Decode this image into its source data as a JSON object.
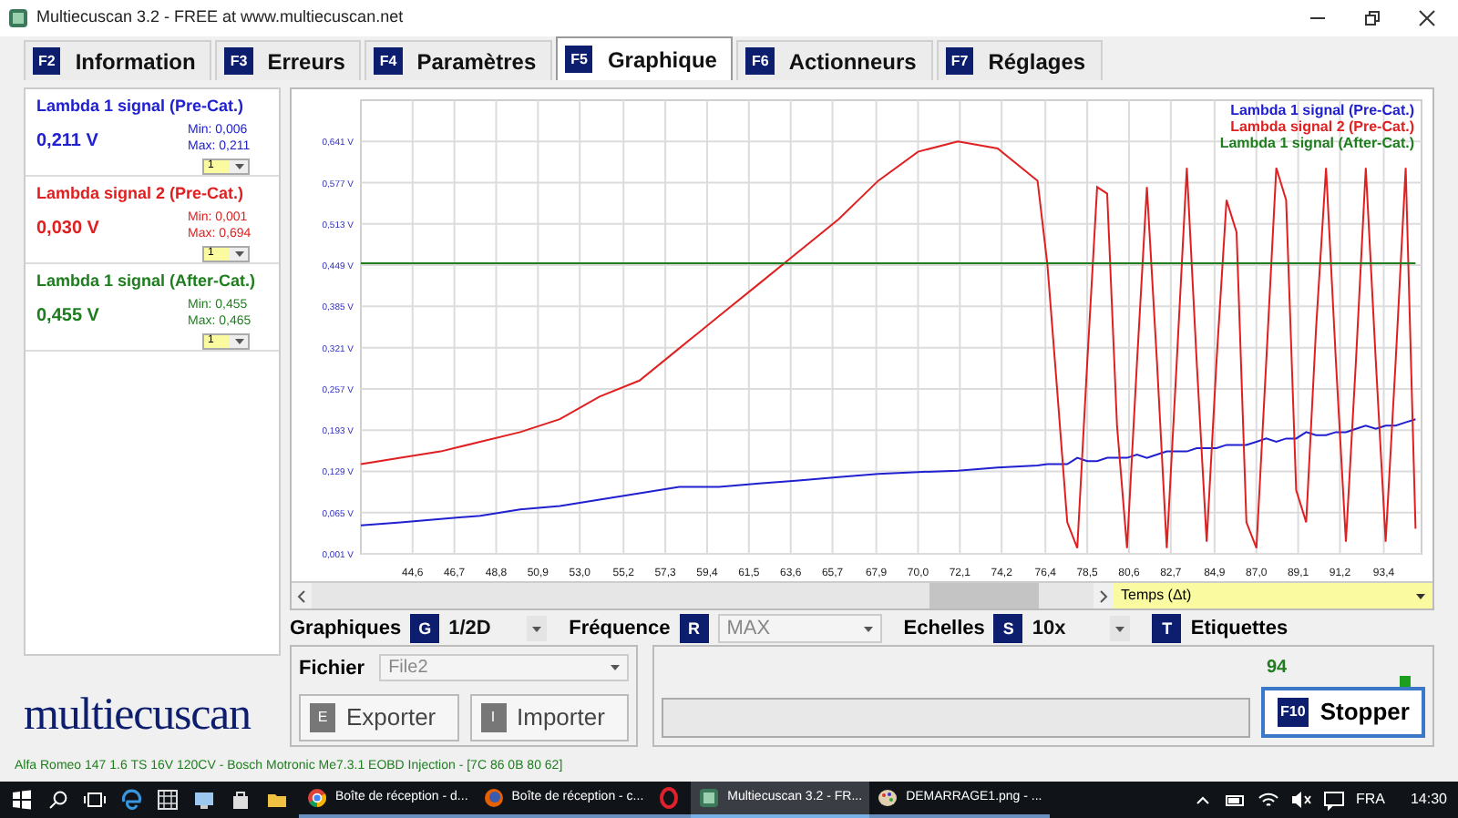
{
  "window": {
    "title": "Multiecuscan 3.2 - FREE at www.multiecuscan.net"
  },
  "tabs": [
    {
      "key": "F2",
      "label": "Information",
      "selected": false
    },
    {
      "key": "F3",
      "label": "Erreurs",
      "selected": false
    },
    {
      "key": "F4",
      "label": "Paramètres",
      "selected": false
    },
    {
      "key": "F5",
      "label": "Graphique",
      "selected": true
    },
    {
      "key": "F6",
      "label": "Actionneurs",
      "selected": false
    },
    {
      "key": "F7",
      "label": "Réglages",
      "selected": false
    }
  ],
  "sensors": [
    {
      "name": "Lambda 1 signal (Pre-Cat.)",
      "value": "0,211 V",
      "min": "Min: 0,006",
      "max": "Max: 0,211",
      "scale": "1",
      "color": "#2020d0"
    },
    {
      "name": "Lambda signal 2 (Pre-Cat.)",
      "value": "0,030 V",
      "min": "Min: 0,001",
      "max": "Max: 0,694",
      "scale": "1",
      "color": "#e02020"
    },
    {
      "name": "Lambda 1 signal (After-Cat.)",
      "value": "0,455 V",
      "min": "Min: 0,455",
      "max": "Max: 0,465",
      "scale": "1",
      "color": "#1e7e1e"
    }
  ],
  "chart": {
    "x_axis_selector": "Temps (Δt)",
    "chart_data": {
      "type": "line",
      "grid": true,
      "xlim": [
        42,
        95.3
      ],
      "ylim": [
        0.001,
        0.705
      ],
      "x": [
        42,
        44,
        46,
        48,
        50,
        52,
        54,
        56,
        58,
        60,
        62,
        64,
        66,
        68,
        70,
        72,
        74,
        76,
        76.5,
        77,
        77.5,
        78,
        78.5,
        79,
        79.5,
        80,
        80.5,
        81,
        81.5,
        82,
        82.5,
        83,
        83.5,
        84,
        84.5,
        85,
        85.5,
        86,
        86.5,
        87,
        87.5,
        88,
        88.5,
        89,
        89.5,
        90,
        90.5,
        91,
        91.5,
        92,
        92.5,
        93,
        93.5,
        94,
        94.5,
        95
      ],
      "series": [
        {
          "name": "Lambda 1 signal (Pre-Cat.)",
          "color": "#2020d0",
          "values": [
            0.045,
            0.05,
            0.055,
            0.06,
            0.07,
            0.075,
            0.085,
            0.095,
            0.105,
            0.105,
            0.11,
            0.115,
            0.12,
            0.125,
            0.128,
            0.13,
            0.135,
            0.138,
            0.14,
            0.14,
            0.14,
            0.15,
            0.145,
            0.145,
            0.15,
            0.15,
            0.15,
            0.155,
            0.15,
            0.155,
            0.16,
            0.16,
            0.16,
            0.165,
            0.165,
            0.165,
            0.17,
            0.17,
            0.17,
            0.175,
            0.18,
            0.175,
            0.18,
            0.18,
            0.19,
            0.185,
            0.185,
            0.19,
            0.19,
            0.195,
            0.2,
            0.195,
            0.2,
            0.2,
            0.205,
            0.21
          ]
        },
        {
          "name": "Lambda signal 2 (Pre-Cat.)",
          "color": "#e02020",
          "values": [
            0.14,
            0.15,
            0.16,
            0.175,
            0.19,
            0.21,
            0.245,
            0.27,
            0.32,
            0.37,
            0.42,
            0.47,
            0.52,
            0.58,
            0.625,
            0.641,
            0.63,
            0.58,
            0.45,
            0.25,
            0.05,
            0.01,
            0.3,
            0.57,
            0.56,
            0.2,
            0.01,
            0.3,
            0.57,
            0.3,
            0.01,
            0.3,
            0.6,
            0.3,
            0.02,
            0.3,
            0.55,
            0.5,
            0.05,
            0.01,
            0.3,
            0.6,
            0.55,
            0.1,
            0.05,
            0.35,
            0.6,
            0.3,
            0.02,
            0.3,
            0.6,
            0.3,
            0.02,
            0.3,
            0.6,
            0.04
          ]
        },
        {
          "name": "Lambda 1 signal (After-Cat.)",
          "color": "#1e7e1e",
          "values": [
            0.452,
            0.452,
            0.452,
            0.452,
            0.452,
            0.452,
            0.452,
            0.452,
            0.452,
            0.452,
            0.452,
            0.452,
            0.452,
            0.452,
            0.452,
            0.452,
            0.452,
            0.452,
            0.452,
            0.452,
            0.452,
            0.452,
            0.452,
            0.452,
            0.452,
            0.452,
            0.452,
            0.452,
            0.452,
            0.452,
            0.452,
            0.452,
            0.452,
            0.452,
            0.452,
            0.452,
            0.452,
            0.452,
            0.452,
            0.452,
            0.452,
            0.452,
            0.452,
            0.452,
            0.452,
            0.452,
            0.452,
            0.452,
            0.452,
            0.452,
            0.452,
            0.452,
            0.452,
            0.452,
            0.452,
            0.452
          ]
        }
      ],
      "yticks": [
        {
          "value": 0.001,
          "label": "0,001 V"
        },
        {
          "value": 0.065,
          "label": "0,065 V"
        },
        {
          "value": 0.129,
          "label": "0,129 V"
        },
        {
          "value": 0.193,
          "label": "0,193 V"
        },
        {
          "value": 0.257,
          "label": "0,257 V"
        },
        {
          "value": 0.321,
          "label": "0,321 V"
        },
        {
          "value": 0.385,
          "label": "0,385 V"
        },
        {
          "value": 0.449,
          "label": "0,449 V"
        },
        {
          "value": 0.513,
          "label": "0,513 V"
        },
        {
          "value": 0.577,
          "label": "0,577 V"
        },
        {
          "value": 0.641,
          "label": "0,641 V"
        }
      ],
      "xticks": [
        {
          "value": 44.6,
          "label": "44,6"
        },
        {
          "value": 46.7,
          "label": "46,7"
        },
        {
          "value": 48.8,
          "label": "48,8"
        },
        {
          "value": 50.9,
          "label": "50,9"
        },
        {
          "value": 53.0,
          "label": "53,0"
        },
        {
          "value": 55.2,
          "label": "55,2"
        },
        {
          "value": 57.3,
          "label": "57,3"
        },
        {
          "value": 59.4,
          "label": "59,4"
        },
        {
          "value": 61.5,
          "label": "61,5"
        },
        {
          "value": 63.6,
          "label": "63,6"
        },
        {
          "value": 65.7,
          "label": "65,7"
        },
        {
          "value": 67.9,
          "label": "67,9"
        },
        {
          "value": 70.0,
          "label": "70,0"
        },
        {
          "value": 72.1,
          "label": "72,1"
        },
        {
          "value": 74.2,
          "label": "74,2"
        },
        {
          "value": 76.4,
          "label": "76,4"
        },
        {
          "value": 78.5,
          "label": "78,5"
        },
        {
          "value": 80.6,
          "label": "80,6"
        },
        {
          "value": 82.7,
          "label": "82,7"
        },
        {
          "value": 84.9,
          "label": "84,9"
        },
        {
          "value": 87.0,
          "label": "87,0"
        },
        {
          "value": 89.1,
          "label": "89,1"
        },
        {
          "value": 91.2,
          "label": "91,2"
        },
        {
          "value": 93.4,
          "label": "93,4"
        }
      ]
    }
  },
  "options": [
    {
      "kind": "select",
      "label": "Graphiques",
      "key": "G",
      "value": "1/2D",
      "disabled": false
    },
    {
      "kind": "select",
      "label": "Fréquence",
      "key": "R",
      "value": "MAX",
      "disabled": true
    },
    {
      "kind": "select",
      "label": "Echelles",
      "key": "S",
      "value": "10x",
      "disabled": false
    },
    {
      "kind": "toggle",
      "label": "Etiquettes",
      "key": "T"
    }
  ],
  "file": {
    "label": "Fichier",
    "value": "File2",
    "disabled": true,
    "buttons": [
      {
        "key": "E",
        "label": "Exporter"
      },
      {
        "key": "I",
        "label": "Importer"
      }
    ]
  },
  "run": {
    "count": "94",
    "button": {
      "key": "F10",
      "label": "Stopper"
    }
  },
  "logo": "multiecuscan",
  "status_bar": "Alfa Romeo 147 1.6 TS 16V 120CV - Bosch Motronic Me7.3.1 EOBD Injection - [7C 86 0B 80 62]",
  "taskbar": {
    "items": [
      {
        "kind": "chrome",
        "label": "Boîte de réception - d...",
        "selected": false
      },
      {
        "kind": "firefox",
        "label": "Boîte de réception - c...",
        "selected": false
      },
      {
        "kind": "opera",
        "selected": false
      },
      {
        "kind": "app",
        "label": "Multiecuscan 3.2 - FR...",
        "selected": true
      },
      {
        "kind": "paint",
        "label": "DEMARRAGE1.png - ...",
        "selected": false
      }
    ],
    "language": "FRA",
    "time": "14:30"
  }
}
